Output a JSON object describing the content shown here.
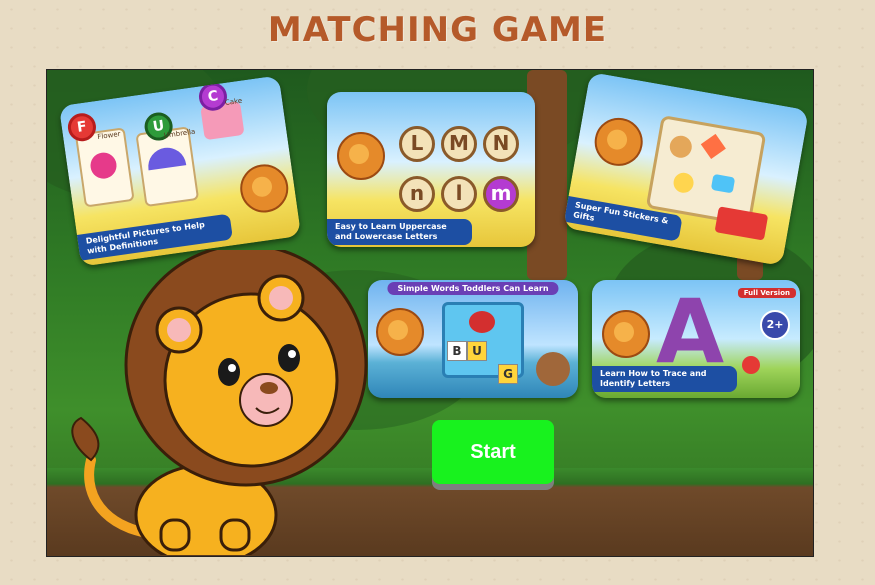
{
  "title": "MATCHING GAME",
  "start_label": "Start",
  "cards": [
    {
      "caption": "Delightful Pictures to Help with Definitions",
      "words": [
        "Flower",
        "Umbrella",
        "Cake"
      ],
      "letters": [
        "F",
        "U",
        "C"
      ]
    },
    {
      "caption": "Easy to Learn Uppercase and Lowercase Letters",
      "letters": [
        "L",
        "M",
        "N",
        "n",
        "l",
        "m"
      ]
    },
    {
      "caption": "Super Fun Stickers & Gifts"
    },
    {
      "header": "Simple Words Toddlers Can Learn",
      "letters": [
        "B",
        "U",
        "G"
      ]
    },
    {
      "caption": "Learn How to Trace and Identify Letters",
      "badge": "Full Version",
      "age": "2+",
      "letter": "A"
    }
  ],
  "colors": {
    "title": "#b55a2a",
    "start_button": "#18f21e",
    "background": "#e8dcc4"
  }
}
